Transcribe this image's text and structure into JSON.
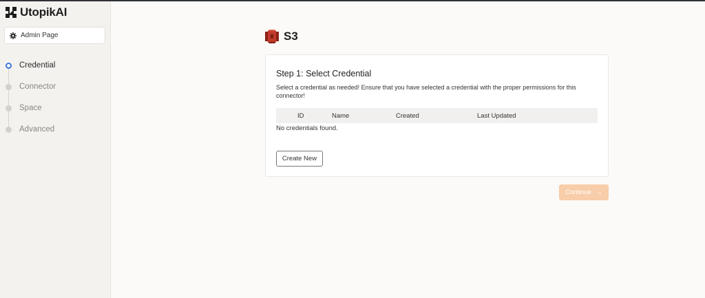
{
  "brand": {
    "name": "UtopikAI"
  },
  "sidebar": {
    "admin_label": "Admin Page",
    "steps": [
      {
        "label": "Credential",
        "active": true
      },
      {
        "label": "Connector",
        "active": false
      },
      {
        "label": "Space",
        "active": false
      },
      {
        "label": "Advanced",
        "active": false
      }
    ]
  },
  "header": {
    "title": "S3",
    "icon": "s3-bucket-icon"
  },
  "card": {
    "title": "Step 1: Select Credential",
    "description": "Select a credential as needed! Ensure that you have selected a credential with the proper permissions for this connector!",
    "columns": [
      "ID",
      "Name",
      "Created",
      "Last Updated"
    ],
    "empty_text": "No credentials found.",
    "create_label": "Create New"
  },
  "footer": {
    "continue_label": "Continue",
    "continue_arrow": "→"
  },
  "colors": {
    "accent": "#3b76d8",
    "continue": "#f8cda9",
    "s3_red": "#c0392b"
  }
}
